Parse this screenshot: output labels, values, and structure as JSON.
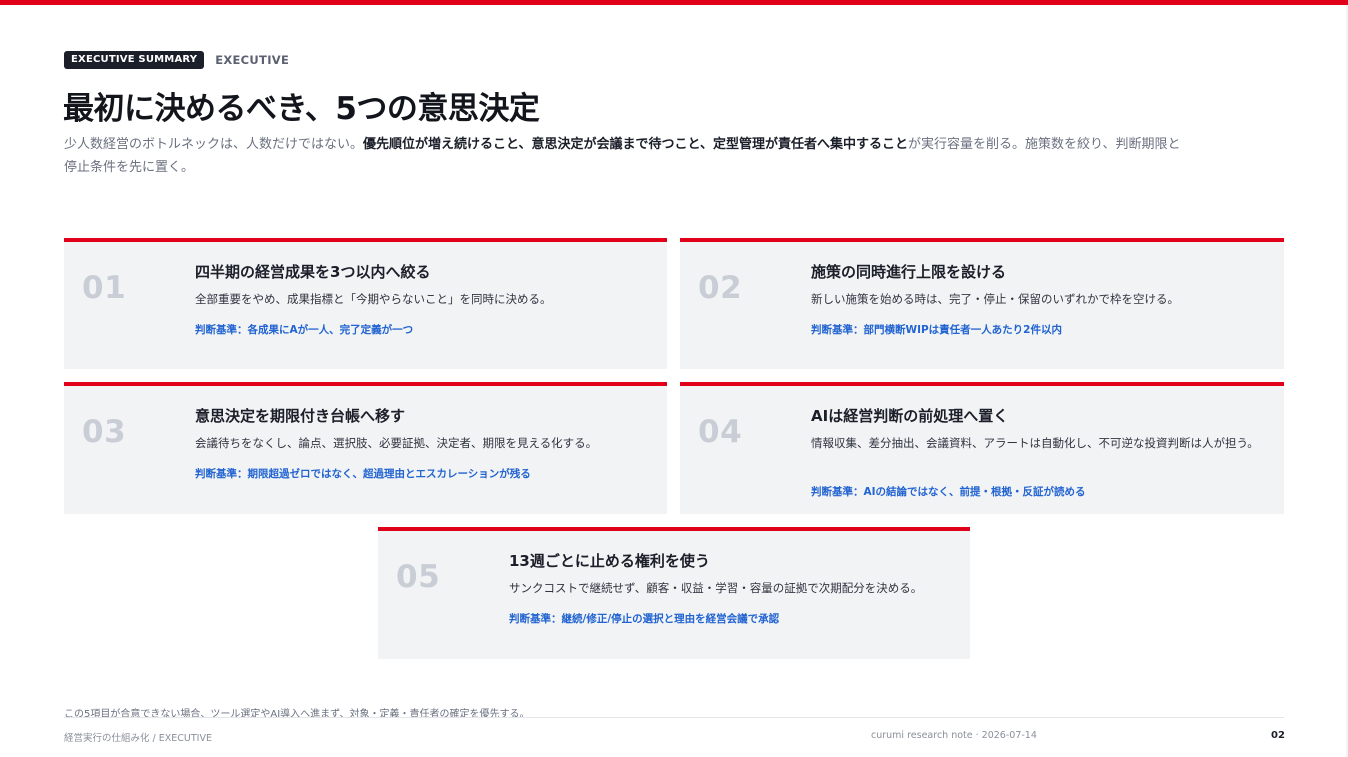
{
  "header": {
    "badge": "EXECUTIVE SUMMARY",
    "tag": "EXECUTIVE",
    "title": "最初に決めるべき、5つの意思決定",
    "lead_part1": "少人数経営のボトルネックは、人数だけではない。",
    "lead_bold": "優先順位が増え続けること、意思決定が会議まで待つこと、定型管理が責任者へ集中すること",
    "lead_part2": "が実行容量を削る。施策数を絞り、判断期限と停止条件を先に置く。"
  },
  "cards": [
    {
      "num": "01",
      "title": "四半期の経営成果を3つ以内へ絞る",
      "desc": "全部重要をやめ、成果指標と「今期やらないこと」を同時に決める。",
      "criterion": "判断基準：各成果にAが一人、完了定義が一つ"
    },
    {
      "num": "02",
      "title": "施策の同時進行上限を設ける",
      "desc": "新しい施策を始める時は、完了・停止・保留のいずれかで枠を空ける。",
      "criterion": "判断基準：部門横断WIPは責任者一人あたり2件以内"
    },
    {
      "num": "03",
      "title": "意思決定を期限付き台帳へ移す",
      "desc": "会議待ちをなくし、論点、選択肢、必要証拠、決定者、期限を見える化する。",
      "criterion": "判断基準：期限超過ゼロではなく、超過理由とエスカレーションが残る"
    },
    {
      "num": "04",
      "title": "AIは経営判断の前処理へ置く",
      "desc": "情報収集、差分抽出、会議資料、アラートは自動化し、不可逆な投資判断は人が担う。",
      "criterion": "判断基準：AIの結論ではなく、前提・根拠・反証が読める"
    },
    {
      "num": "05",
      "title": "13週ごとに止める権利を使う",
      "desc": "サンクコストで継続せず、顧客・収益・学習・容量の証拠で次期配分を決める。",
      "criterion": "判断基準：継続/修正/停止の選択と理由を経営会議で承認"
    }
  ],
  "footer": {
    "note": "この5項目が合意できない場合、ツール選定やAI導入へ進まず、対象・定義・責任者の確定を優先する。",
    "left": "経営実行の仕組み化 / EXECUTIVE",
    "mid": "curumi research note · 2026-07-14",
    "page": "02"
  },
  "colors": {
    "accent": "#e1001a",
    "criterion": "#2264d1",
    "card_bg": "#f2f3f5"
  }
}
